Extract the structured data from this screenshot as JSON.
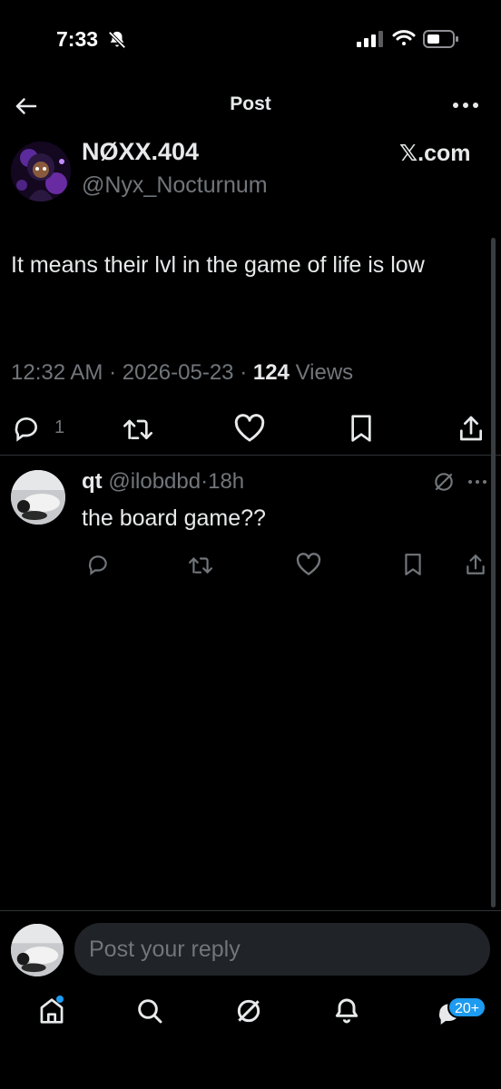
{
  "status_bar": {
    "time": "7:33"
  },
  "header": {
    "title": "Post"
  },
  "post": {
    "author_name": "NØXX.404",
    "author_handle": "@Nyx_Nocturnum",
    "source": "𝕏.com",
    "text": "It means their lvl in the game of life is low",
    "time": "12:32 AM",
    "separator": "·",
    "date": "2026-05-23",
    "views_count": "124",
    "views_label": "Views",
    "reply_count": "1"
  },
  "reply": {
    "name": "qt",
    "handle": "@ilobdbd",
    "separator": "·",
    "age": "18h",
    "text": "the board game??"
  },
  "composer": {
    "placeholder": "Post your reply"
  },
  "bottom_nav": {
    "messages_badge": "20+"
  },
  "colors": {
    "background": "#000000",
    "text_primary": "#e7e9ea",
    "text_secondary": "#71767b",
    "accent": "#1d9bf0",
    "divider": "#2f3336",
    "input_background": "#202327"
  }
}
